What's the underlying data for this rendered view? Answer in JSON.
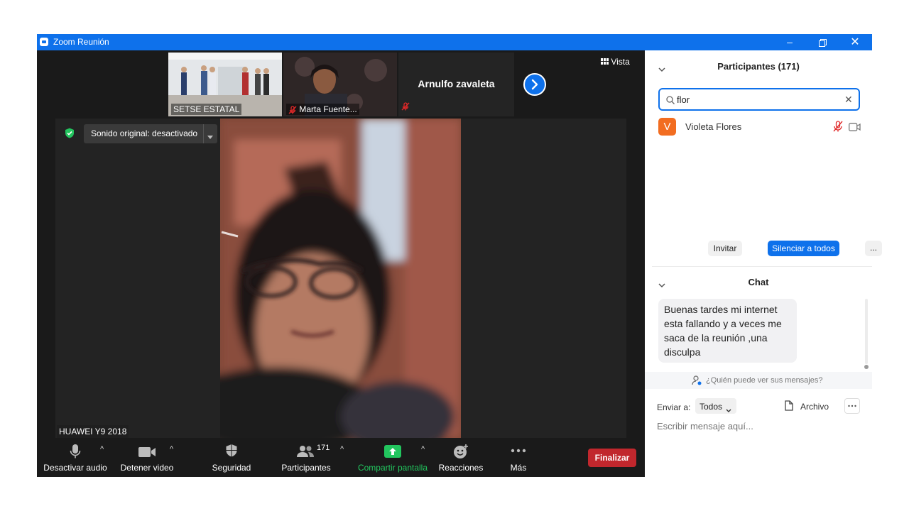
{
  "window": {
    "title": "Zoom Reunión"
  },
  "top_bar": {
    "view_label": "Vista",
    "next_page_label": ""
  },
  "thumbnails": [
    {
      "name": "SETSE ESTATAL"
    },
    {
      "name": "Marta Fuente..."
    },
    {
      "name": "Arnulfo zavaleta"
    }
  ],
  "main_video": {
    "sound_toggle": "Sonido original: desactivado",
    "name": "HUAWEI Y9 2018"
  },
  "toolbar": {
    "audio": "Desactivar audio",
    "video": "Detener video",
    "security": "Seguridad",
    "participants": "Participantes",
    "participants_count": "171",
    "share": "Compartir pantalla",
    "reactions": "Reacciones",
    "more": "Más",
    "end": "Finalizar"
  },
  "participants_panel": {
    "header": "Participantes (171)",
    "search_value": "flor",
    "results": [
      {
        "initial": "V",
        "name": "Violeta Flores"
      }
    ],
    "invite": "Invitar",
    "mute_all": "Silenciar a todos",
    "more": "..."
  },
  "chat_panel": {
    "header": "Chat",
    "messages": [
      {
        "text": "Buenas tardes mi internet esta fallando y a veces me saca de la reunión ,una disculpa"
      }
    ],
    "visibility_note": "¿Quién puede ver sus mensajes?",
    "send_to_label": "Enviar a:",
    "send_to_value": "Todos",
    "file_label": "Archivo",
    "input_placeholder": "Escribir mensaje aquí..."
  },
  "colors": {
    "zoom_blue": "#0e71eb",
    "end_red": "#c1272d",
    "share_green": "#22c55e",
    "avatar_orange": "#f26d21"
  }
}
